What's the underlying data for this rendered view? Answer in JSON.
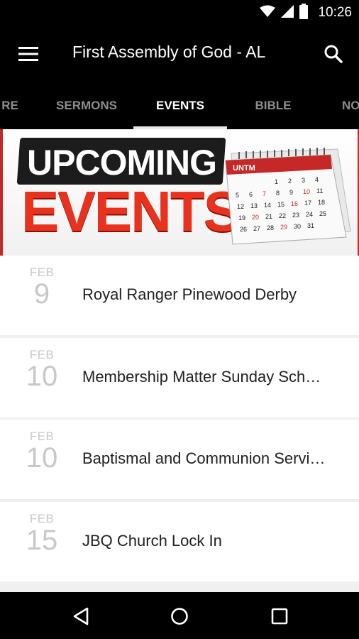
{
  "status_bar": {
    "time": "10:26",
    "icons": [
      "wifi-icon",
      "signal-icon",
      "battery-icon"
    ]
  },
  "app_bar": {
    "title": "First Assembly of God - AL",
    "icons": [
      "menu-icon",
      "search-icon"
    ]
  },
  "tabs": [
    {
      "label": "RE",
      "active": false
    },
    {
      "label": "SERMONS",
      "active": false
    },
    {
      "label": "EVENTS",
      "active": true
    },
    {
      "label": "BIBLE",
      "active": false
    },
    {
      "label": "NO",
      "active": false
    }
  ],
  "banner": {
    "line1": "UPCOMING",
    "line2": "EVENTS",
    "calendar_header": "UNTM",
    "calendar_numbers": [
      "1",
      "2",
      "3",
      "4",
      "5",
      "6",
      "7",
      "8",
      "9",
      "10",
      "11",
      "12",
      "13",
      "14",
      "15",
      "16",
      "17",
      "18",
      "19",
      "20",
      "21",
      "22",
      "23",
      "24",
      "25",
      "26",
      "27",
      "28",
      "29",
      "30",
      "31"
    ]
  },
  "events": [
    {
      "month": "FEB",
      "day": "9",
      "title": "Royal Ranger Pinewood Derby"
    },
    {
      "month": "FEB",
      "day": "10",
      "title": "Membership Matter Sunday Sch…"
    },
    {
      "month": "FEB",
      "day": "10",
      "title": "Baptismal and Communion Servi…"
    },
    {
      "month": "FEB",
      "day": "15",
      "title": "JBQ Church Lock In"
    }
  ],
  "nav_bar": {
    "icons": [
      "back-icon",
      "home-icon",
      "recents-icon"
    ]
  },
  "colors": {
    "app_bar": "#000000",
    "accent_red": "#c62828",
    "date_gray": "#c8c8c8",
    "title_text": "#212121"
  }
}
